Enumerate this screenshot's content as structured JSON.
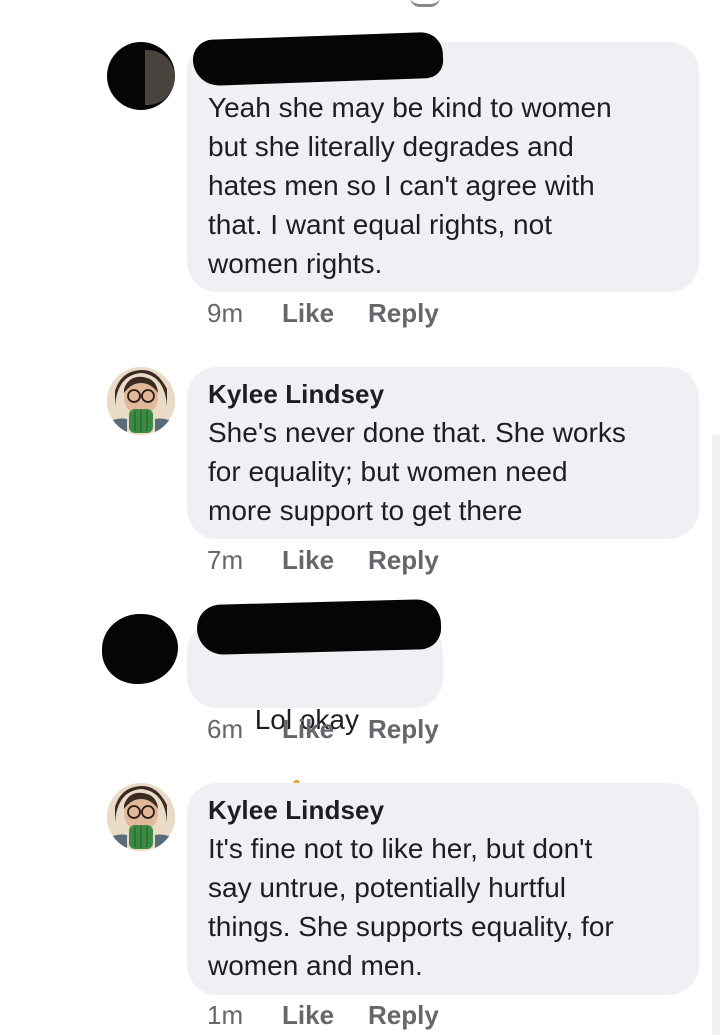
{
  "comments": [
    {
      "author": "",
      "author_redacted": true,
      "text": "Yeah she may be kind to women\nbut she literally degrades and\nhates men so I can't agree with\nthat. I want equal rights, not\nwomen rights.",
      "time": "9m",
      "like": "Like",
      "reply": "Reply"
    },
    {
      "author": "Kylee Lindsey",
      "author_redacted": false,
      "text": "She's never done that. She works\nfor equality; but women need\nmore support to get there",
      "time": "7m",
      "like": "Like",
      "reply": "Reply"
    },
    {
      "author": "",
      "author_redacted": true,
      "text": "Lol okay",
      "emoji": "thumbs-up-icon",
      "time": "6m",
      "like": "Like",
      "reply": "Reply"
    },
    {
      "author": "Kylee Lindsey",
      "author_redacted": false,
      "text": "It's fine not to like her, but don't\nsay untrue, potentially hurtful\nthings. She supports equality, for\nwomen and men.",
      "time": "1m",
      "like": "Like",
      "reply": "Reply"
    }
  ],
  "colors": {
    "bubble": "#eff0f3",
    "meta_text": "#65676b",
    "text": "#1c1e21",
    "redaction": "#050505"
  }
}
